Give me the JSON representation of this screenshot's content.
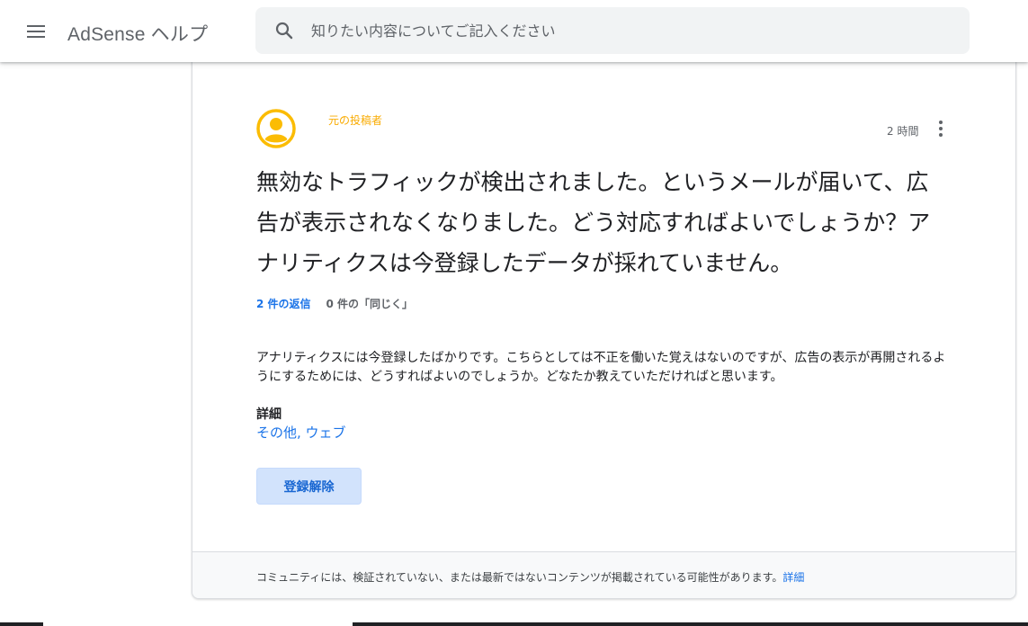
{
  "header": {
    "product_title": "AdSense ヘルプ",
    "search_placeholder": "知りたい内容についてご記入ください",
    "menu_icon": "hamburger-menu-icon",
    "search_icon": "search-icon"
  },
  "post": {
    "author_role": "元の投稿者",
    "timestamp": "2 時間",
    "title": "無効なトラフィックが検出されました。というメールが届いて、広告が表示されなくなりました。どう対応すればよいでしょうか？アナリティクスは今登録したデータが採れていません。",
    "replies_link": "2 件の返信",
    "same_count": "0 件の「同じく」",
    "body": "アナリティクスには今登録したばかりです。こちらとしては不正を働いた覚えはないのですが、広告の表示が再開されるようにするためには、どうすればよいのでしょうか。どなたか教えていただければと思います。",
    "details_label": "詳細",
    "details_tags": "その他, ウェブ",
    "unsubscribe_label": "登録解除"
  },
  "footer": {
    "notice": "コミュニティには、検証されていない、または最新ではないコンテンツが掲載されている可能性があります。",
    "details_link": "詳細"
  },
  "colors": {
    "accent_blue": "#1a73e8",
    "author_role_yellow": "#f9ab00",
    "avatar_yellow": "#fbbc04",
    "button_bg": "#d2e3fc"
  }
}
